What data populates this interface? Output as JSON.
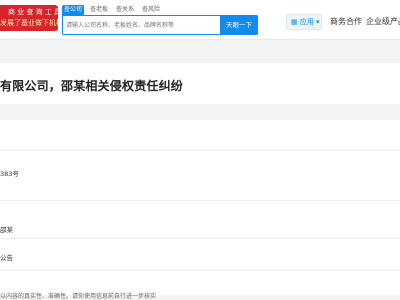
{
  "header": {
    "logo": {
      "line1": "商 业 查 询 工 具",
      "line2": "发展了基业做下机构"
    },
    "search": {
      "tabs": [
        "查公司",
        "查老板",
        "查关系",
        "查风险"
      ],
      "placeholder": "请输入公司名称、老板姓名、品牌名称等",
      "button": "天眼一下"
    },
    "app_button": "应用",
    "nav_links": [
      "商务合作",
      "企业级产品"
    ]
  },
  "case": {
    "title": "有限公司，邵某相关侵权责任纠纷",
    "number_fragment": "383号",
    "party_fragment": "邵某",
    "type_fragment": "公告",
    "disclaimer": "以内容的真实性、准确性。请你使用信息前自行进一步核实"
  },
  "colors": {
    "accent": "#128bed",
    "brand": "#d9242b"
  }
}
